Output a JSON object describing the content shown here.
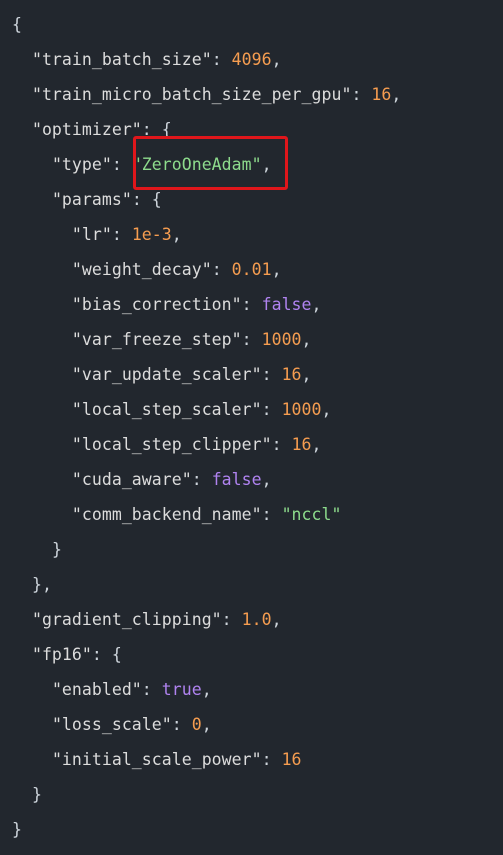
{
  "code": {
    "lines": [
      [
        {
          "t": "{",
          "k": "punct"
        }
      ],
      [
        {
          "t": "  ",
          "k": "ws"
        },
        {
          "t": "\"train_batch_size\"",
          "k": "key"
        },
        {
          "t": ": ",
          "k": "punct"
        },
        {
          "t": "4096",
          "k": "number"
        },
        {
          "t": ",",
          "k": "punct"
        }
      ],
      [
        {
          "t": "  ",
          "k": "ws"
        },
        {
          "t": "\"train_micro_batch_size_per_gpu\"",
          "k": "key"
        },
        {
          "t": ": ",
          "k": "punct"
        },
        {
          "t": "16",
          "k": "number"
        },
        {
          "t": ",",
          "k": "punct"
        }
      ],
      [
        {
          "t": "  ",
          "k": "ws"
        },
        {
          "t": "\"optimizer\"",
          "k": "key"
        },
        {
          "t": ": {",
          "k": "punct"
        }
      ],
      [
        {
          "t": "    ",
          "k": "ws"
        },
        {
          "t": "\"type\"",
          "k": "key"
        },
        {
          "t": ": ",
          "k": "punct"
        },
        {
          "t": "\"ZeroOneAdam\"",
          "k": "string"
        },
        {
          "t": ",",
          "k": "punct"
        }
      ],
      [
        {
          "t": "    ",
          "k": "ws"
        },
        {
          "t": "\"params\"",
          "k": "key"
        },
        {
          "t": ": {",
          "k": "punct"
        }
      ],
      [
        {
          "t": "      ",
          "k": "ws"
        },
        {
          "t": "\"lr\"",
          "k": "key"
        },
        {
          "t": ": ",
          "k": "punct"
        },
        {
          "t": "1e-3",
          "k": "number"
        },
        {
          "t": ",",
          "k": "punct"
        }
      ],
      [
        {
          "t": "      ",
          "k": "ws"
        },
        {
          "t": "\"weight_decay\"",
          "k": "key"
        },
        {
          "t": ": ",
          "k": "punct"
        },
        {
          "t": "0.01",
          "k": "number"
        },
        {
          "t": ",",
          "k": "punct"
        }
      ],
      [
        {
          "t": "      ",
          "k": "ws"
        },
        {
          "t": "\"bias_correction\"",
          "k": "key"
        },
        {
          "t": ": ",
          "k": "punct"
        },
        {
          "t": "false",
          "k": "bool"
        },
        {
          "t": ",",
          "k": "punct"
        }
      ],
      [
        {
          "t": "      ",
          "k": "ws"
        },
        {
          "t": "\"var_freeze_step\"",
          "k": "key"
        },
        {
          "t": ": ",
          "k": "punct"
        },
        {
          "t": "1000",
          "k": "number"
        },
        {
          "t": ",",
          "k": "punct"
        }
      ],
      [
        {
          "t": "      ",
          "k": "ws"
        },
        {
          "t": "\"var_update_scaler\"",
          "k": "key"
        },
        {
          "t": ": ",
          "k": "punct"
        },
        {
          "t": "16",
          "k": "number"
        },
        {
          "t": ",",
          "k": "punct"
        }
      ],
      [
        {
          "t": "      ",
          "k": "ws"
        },
        {
          "t": "\"local_step_scaler\"",
          "k": "key"
        },
        {
          "t": ": ",
          "k": "punct"
        },
        {
          "t": "1000",
          "k": "number"
        },
        {
          "t": ",",
          "k": "punct"
        }
      ],
      [
        {
          "t": "      ",
          "k": "ws"
        },
        {
          "t": "\"local_step_clipper\"",
          "k": "key"
        },
        {
          "t": ": ",
          "k": "punct"
        },
        {
          "t": "16",
          "k": "number"
        },
        {
          "t": ",",
          "k": "punct"
        }
      ],
      [
        {
          "t": "      ",
          "k": "ws"
        },
        {
          "t": "\"cuda_aware\"",
          "k": "key"
        },
        {
          "t": ": ",
          "k": "punct"
        },
        {
          "t": "false",
          "k": "bool"
        },
        {
          "t": ",",
          "k": "punct"
        }
      ],
      [
        {
          "t": "      ",
          "k": "ws"
        },
        {
          "t": "\"comm_backend_name\"",
          "k": "key"
        },
        {
          "t": ": ",
          "k": "punct"
        },
        {
          "t": "\"nccl\"",
          "k": "string"
        }
      ],
      [
        {
          "t": "    ",
          "k": "ws"
        },
        {
          "t": "}",
          "k": "punct"
        }
      ],
      [
        {
          "t": "  ",
          "k": "ws"
        },
        {
          "t": "},",
          "k": "punct"
        }
      ],
      [
        {
          "t": "  ",
          "k": "ws"
        },
        {
          "t": "\"gradient_clipping\"",
          "k": "key"
        },
        {
          "t": ": ",
          "k": "punct"
        },
        {
          "t": "1.0",
          "k": "number"
        },
        {
          "t": ",",
          "k": "punct"
        }
      ],
      [
        {
          "t": "  ",
          "k": "ws"
        },
        {
          "t": "\"fp16\"",
          "k": "key"
        },
        {
          "t": ": {",
          "k": "punct"
        }
      ],
      [
        {
          "t": "    ",
          "k": "ws"
        },
        {
          "t": "\"enabled\"",
          "k": "key"
        },
        {
          "t": ": ",
          "k": "punct"
        },
        {
          "t": "true",
          "k": "bool"
        },
        {
          "t": ",",
          "k": "punct"
        }
      ],
      [
        {
          "t": "    ",
          "k": "ws"
        },
        {
          "t": "\"loss_scale\"",
          "k": "key"
        },
        {
          "t": ": ",
          "k": "punct"
        },
        {
          "t": "0",
          "k": "number"
        },
        {
          "t": ",",
          "k": "punct"
        }
      ],
      [
        {
          "t": "    ",
          "k": "ws"
        },
        {
          "t": "\"initial_scale_power\"",
          "k": "key"
        },
        {
          "t": ": ",
          "k": "punct"
        },
        {
          "t": "16",
          "k": "number"
        }
      ],
      [
        {
          "t": "  ",
          "k": "ws"
        },
        {
          "t": "}",
          "k": "punct"
        }
      ],
      [
        {
          "t": "}",
          "k": "punct"
        }
      ]
    ]
  },
  "highlight": {
    "line": 4,
    "color": "#e0161b"
  },
  "colors": {
    "background": "#22272e",
    "key": "#dcdcdc",
    "number": "#f69d50",
    "string": "#8ddb8c",
    "bool": "#b083f0"
  }
}
